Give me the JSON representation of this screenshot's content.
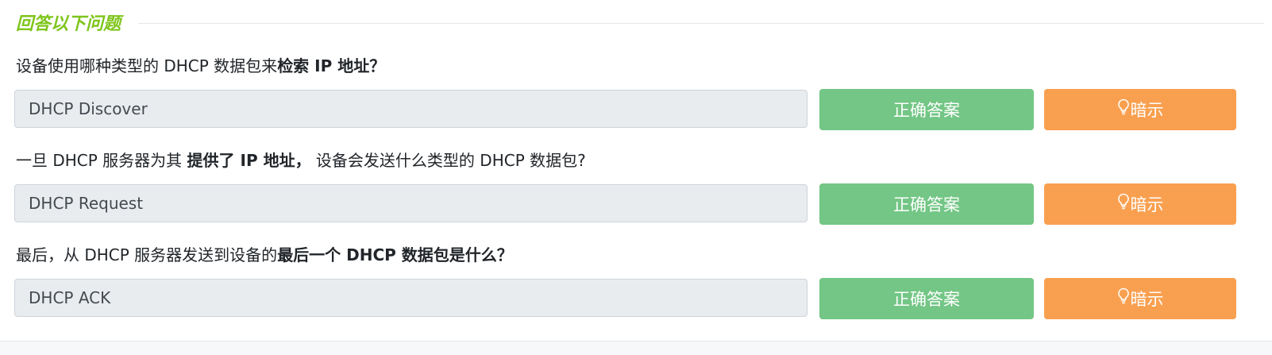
{
  "section": {
    "title": "回答以下问题"
  },
  "questions": [
    {
      "parts": [
        "设备使用哪种类型的 DHCP 数据包来",
        "检索 IP 地址？"
      ],
      "answer": "DHCP Discover",
      "answer_button": "正确答案",
      "hint_button": "暗示"
    },
    {
      "parts": [
        "一旦 DHCP 服务器为其 ",
        "提供了 IP 地址，",
        " 设备会发送什么类型的 DHCP 数据包?"
      ],
      "answer": "DHCP Request",
      "answer_button": "正确答案",
      "hint_button": "暗示"
    },
    {
      "parts": [
        "最后，从 DHCP 服务器发送到设备的",
        "最后一个 DHCP 数据包是什么？"
      ],
      "answer": "DHCP ACK",
      "answer_button": "正确答案",
      "hint_button": "暗示"
    }
  ],
  "colors": {
    "title": "#7ec51b",
    "answer_button": "#73c685",
    "hint_button": "#f9a050",
    "answer_box": "#e9ecef"
  },
  "icons": {
    "hint": "lightbulb-icon"
  }
}
